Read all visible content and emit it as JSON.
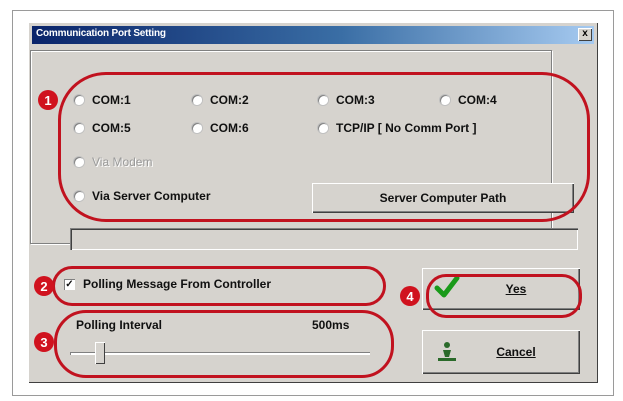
{
  "window": {
    "title": "Communication Port Setting",
    "close_glyph": "x"
  },
  "ports": {
    "com1": "COM:1",
    "com2": "COM:2",
    "com3": "COM:3",
    "com4": "COM:4",
    "com5": "COM:5",
    "com6": "COM:6",
    "tcpip": "TCP/IP [ No Comm Port ]",
    "via_modem": "Via Modem",
    "via_server": "Via Server Computer"
  },
  "server_path_button": "Server Computer Path",
  "polling": {
    "checkbox_label": "Polling Message From Controller",
    "checkbox_mark": "✓",
    "interval_label": "Polling Interval",
    "interval_value": "500ms"
  },
  "buttons": {
    "yes_label": "Yes",
    "cancel_label": "Cancel"
  },
  "annotations": {
    "badge1": "1",
    "badge2": "2",
    "badge3": "3",
    "badge4": "4",
    "color": "#c1121f"
  },
  "icons": {
    "yes": "green-checkmark-icon",
    "cancel": "cancel-figure-icon"
  }
}
